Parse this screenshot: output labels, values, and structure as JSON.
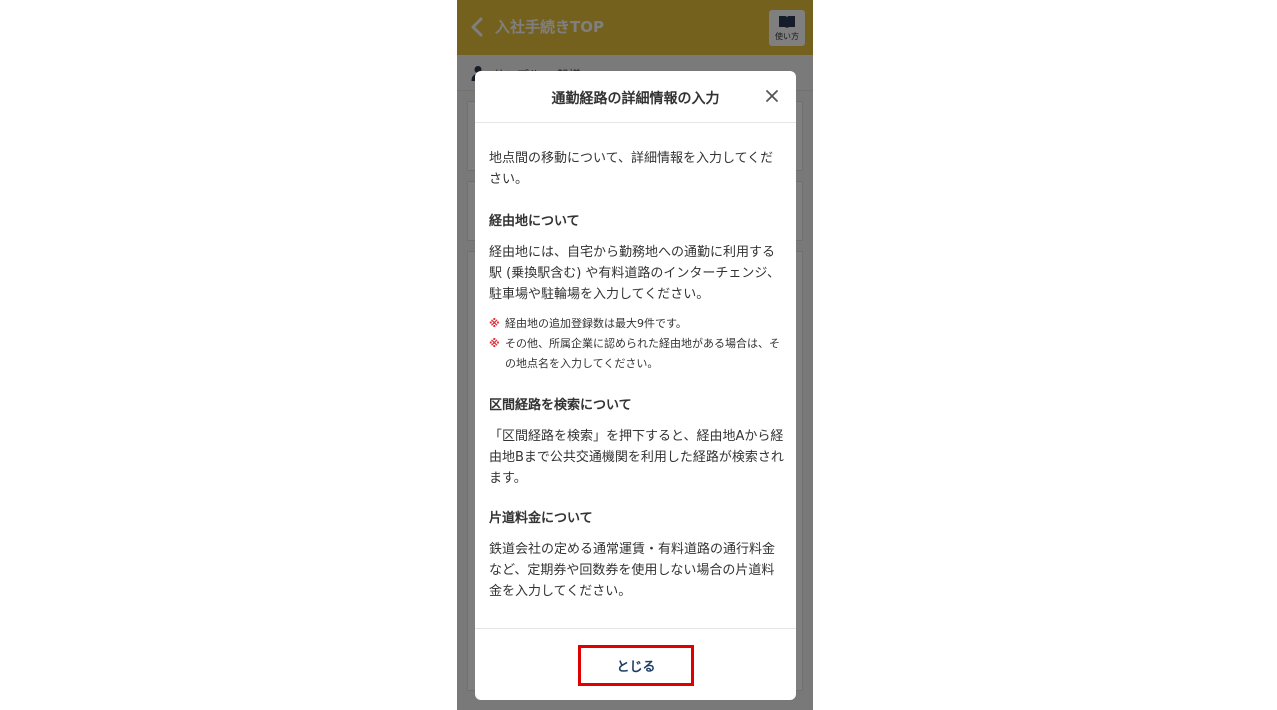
{
  "appbar": {
    "title": "入社手続きTOP",
    "usage_label": "使い方",
    "bg_color": "#e9c23c",
    "icons": {
      "back": "chevron-left-icon",
      "usage": "book-icon"
    }
  },
  "user": {
    "name": "サンプル 一郎様",
    "icon": "person-icon"
  },
  "modal": {
    "title": "通勤経路の詳細情報の入力",
    "close_icon": "close-icon",
    "intro": "地点間の移動について、詳細情報を入力してください。",
    "sections": [
      {
        "heading": "経由地について",
        "body": "経由地には、自宅から勤務地への通勤に利用する駅 (乗換駅含む) や有料道路のインターチェンジ、駐車場や駐輪場を入力してください。",
        "notes": [
          {
            "mark": "※",
            "text": "経由地の追加登録数は最大9件です。"
          },
          {
            "mark": "※",
            "text": "その他、所属企業に認められた経由地がある場合は、その地点名を入力してください。"
          }
        ]
      },
      {
        "heading": "区間経路を検索について",
        "body": "「区間経路を検索」を押下すると、経由地Aから経由地Bまで公共交通機関を利用した経路が検索されます。"
      },
      {
        "heading": "片道料金について",
        "body": "鉄道会社の定める通常運賃・有料道路の通行料金など、定期券や回数券を使用しない場合の片道料金を入力してください。"
      }
    ],
    "close_button_label": "とじる",
    "highlight_color": "#e00000"
  }
}
